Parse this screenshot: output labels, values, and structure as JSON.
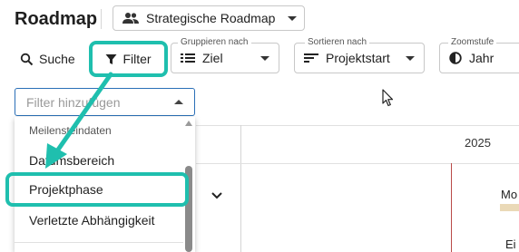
{
  "header": {
    "title": "Roadmap",
    "view_selector": "Strategische Roadmap"
  },
  "toolbar": {
    "search_label": "Suche",
    "filter_label": "Filter",
    "group_by": {
      "label": "Gruppieren nach",
      "value": "Ziel"
    },
    "sort_by": {
      "label": "Sortieren nach",
      "value": "Projektstart"
    },
    "zoom": {
      "label": "Zoomstufe",
      "value": "Jahr"
    }
  },
  "filter_input": {
    "placeholder": "Filter hinzufügen"
  },
  "dropdown": {
    "group_header": "Meilensteindaten",
    "items": [
      {
        "label": "Datumsbereich"
      },
      {
        "label": "Projektphase",
        "highlighted": true
      },
      {
        "label": "Verletzte Abhängigkeit"
      }
    ]
  },
  "timeline": {
    "year": "2025",
    "bar_label": "Mo",
    "row_label": "Ei"
  },
  "colors": {
    "accent_highlight": "#1fbfae",
    "today_line": "#b94a48",
    "input_focus": "#2a6fb7",
    "bar": "#ead9b7"
  }
}
